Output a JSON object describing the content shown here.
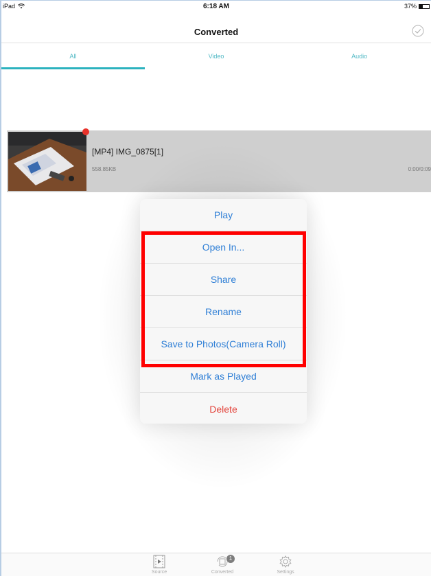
{
  "status_bar": {
    "device": "iPad",
    "time": "6:18 AM",
    "battery_text": "37%",
    "battery_level": 0.37
  },
  "nav": {
    "title": "Converted"
  },
  "tabs": [
    {
      "label": "All",
      "active": true
    },
    {
      "label": "Video",
      "active": false
    },
    {
      "label": "Audio",
      "active": false
    }
  ],
  "media_item": {
    "title": "[MP4] IMG_0875[1]",
    "size": "558.85KB",
    "duration": "0:00/0:09"
  },
  "action_sheet": {
    "items": [
      {
        "label": "Play"
      },
      {
        "label": "Open In..."
      },
      {
        "label": "Share"
      },
      {
        "label": "Rename"
      },
      {
        "label": "Save to Photos(Camera Roll)"
      },
      {
        "label": "Mark as Played"
      },
      {
        "label": "Delete"
      }
    ]
  },
  "tab_bar": {
    "items": [
      {
        "label": "Source"
      },
      {
        "label": "Converted",
        "badge": "1"
      },
      {
        "label": "Settings"
      }
    ]
  },
  "colors": {
    "accent": "#2bb2be",
    "link": "#2f7fd6",
    "danger": "#e3463e",
    "highlight": "#ff0000"
  }
}
